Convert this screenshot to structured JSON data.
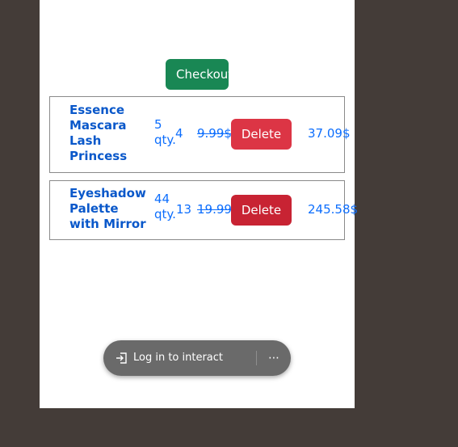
{
  "checkout": {
    "label": "Checkout"
  },
  "cart": {
    "items": [
      {
        "name": "Essence Mascara Lash Princess",
        "qty": "5 qty.",
        "count": "4",
        "original_price": "9.99$",
        "delete_label": "Delete",
        "total": "37.09$"
      },
      {
        "name": "Eyeshadow Palette with Mirror",
        "qty": "44 qty.",
        "count": "13",
        "original_price": "19.99$",
        "delete_label": "Delete",
        "total": "245.58$"
      }
    ]
  },
  "overlay": {
    "login_label": "Log in to interact",
    "login_icon": "login-icon",
    "more_icon": "more-horizontal-icon"
  },
  "colors": {
    "checkout": "#198754",
    "delete": "#dc3545",
    "link": "#0d6efd",
    "backdrop": "#443c38"
  }
}
